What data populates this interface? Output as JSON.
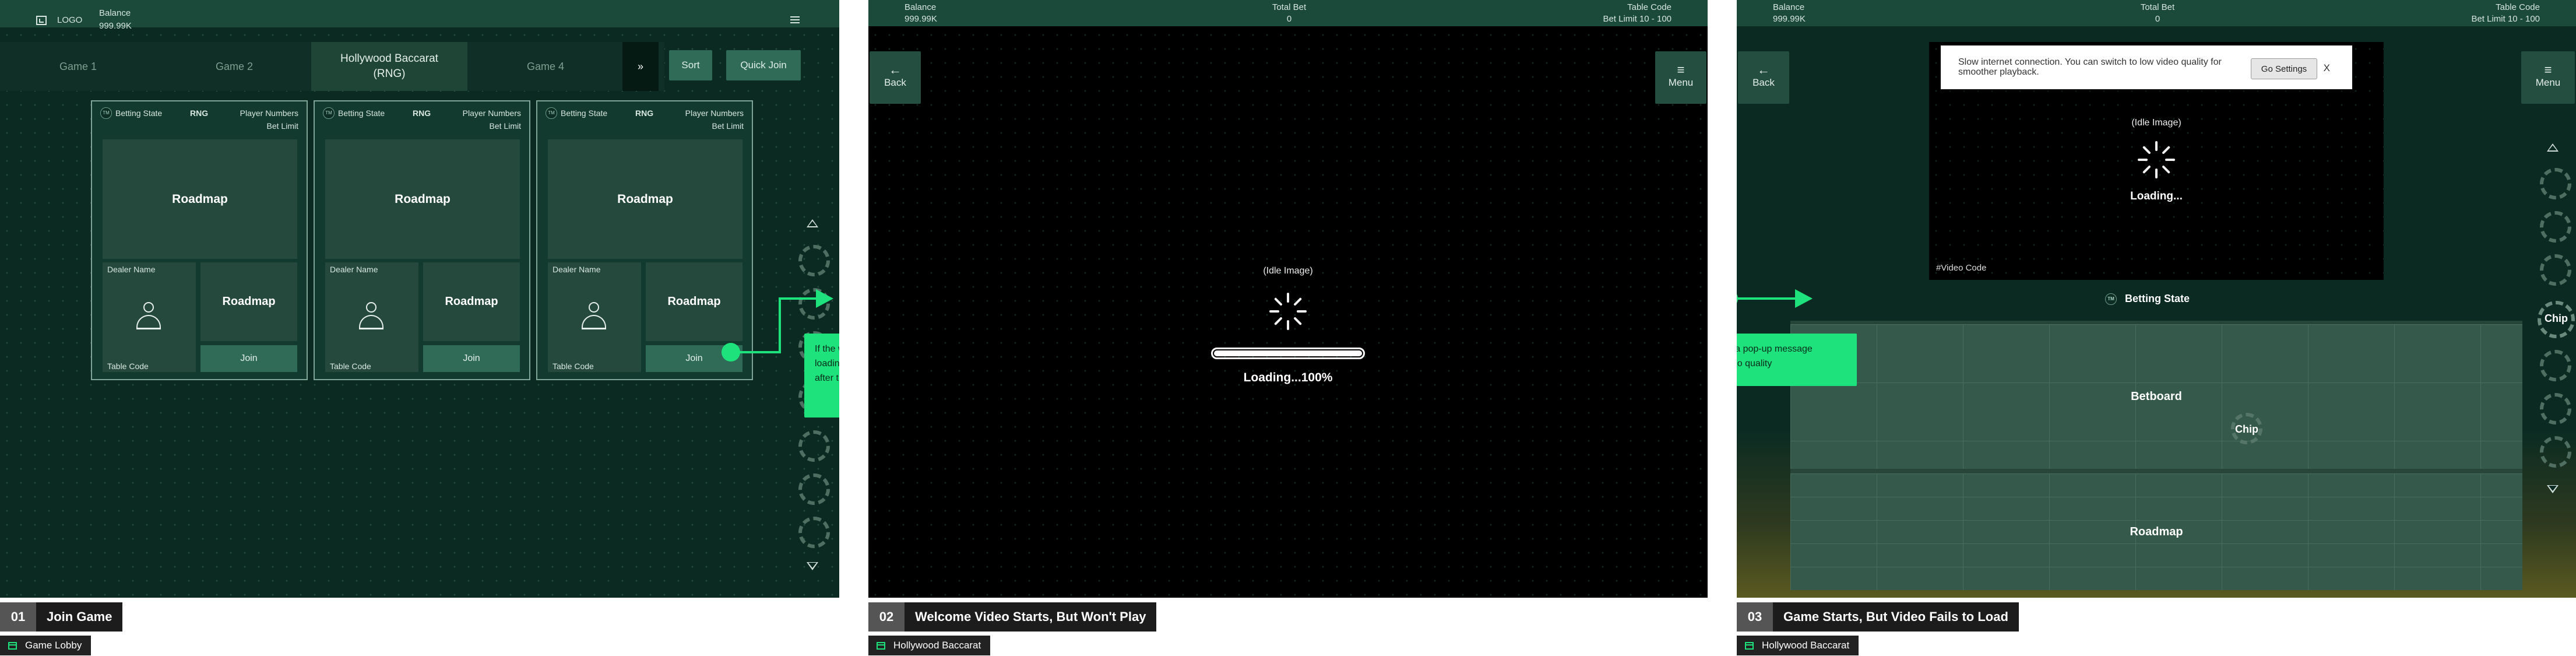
{
  "screen1": {
    "logo": "LOGO",
    "balance_label": "Balance",
    "balance_value": "999.99K",
    "tabs": [
      "Game 1",
      "Game 2",
      "Hollywood Baccarat\n(RNG)",
      "Game 4"
    ],
    "tab_next": "»",
    "sort": "Sort",
    "quick_join": "Quick Join",
    "card": {
      "logo": "TM",
      "betting_state": "Betting State",
      "rng": "RNG",
      "player_numbers": "Player Numbers",
      "bet_limit": "Bet Limit",
      "roadmap": "Roadmap",
      "dealer_name": "Dealer Name",
      "table_code": "Table Code",
      "join": "Join"
    },
    "note": "If the welcome video cannot be loaded, a loading spinner appears and the game launches after the original welcome video ends"
  },
  "screen2": {
    "balance_label": "Balance",
    "balance_value": "999.99K",
    "total_bet_label": "Total Bet",
    "total_bet_value": "0",
    "table_code_label": "Table Code",
    "bet_limit_value": "Bet Limit 10 - 100",
    "back": "Back",
    "menu": "Menu",
    "idle_image": "(Idle Image)",
    "loading": "Loading...100%",
    "progress": 1.0
  },
  "screen3": {
    "balance_label": "Balance",
    "balance_value": "999.99K",
    "total_bet_label": "Total Bet",
    "total_bet_value": "0",
    "table_code_label": "Table Code",
    "bet_limit_value": "Bet Limit 10 - 100",
    "back": "Back",
    "menu": "Menu",
    "popup_msg": "Slow internet connection. You can switch to low video quality for smoother playback.",
    "go_settings": "Go Settings",
    "close": "X",
    "idle_image": "(Idle Image)",
    "loading": "Loading...",
    "video_code": "#Video Code",
    "betting_state_logo": "TM",
    "betting_state": "Betting State",
    "betboard": "Betboard",
    "chip": "Chip",
    "roadmap": "Roadmap",
    "note": "If videos still cannot be loaded, a pop-up message prompts users to adjust the video quality"
  },
  "captions": [
    {
      "num": "01",
      "title": "Join Game",
      "sub": "Game Lobby"
    },
    {
      "num": "02",
      "title": "Welcome Video Starts, But Won't Play",
      "sub": "Hollywood Baccarat"
    },
    {
      "num": "03",
      "title": "Game Starts, But Video Fails to Load",
      "sub": "Hollywood Baccarat"
    }
  ],
  "colors": {
    "accent": "#1ee37d",
    "table_green": "#0b2b22",
    "bar_green": "#1b4a3b"
  }
}
